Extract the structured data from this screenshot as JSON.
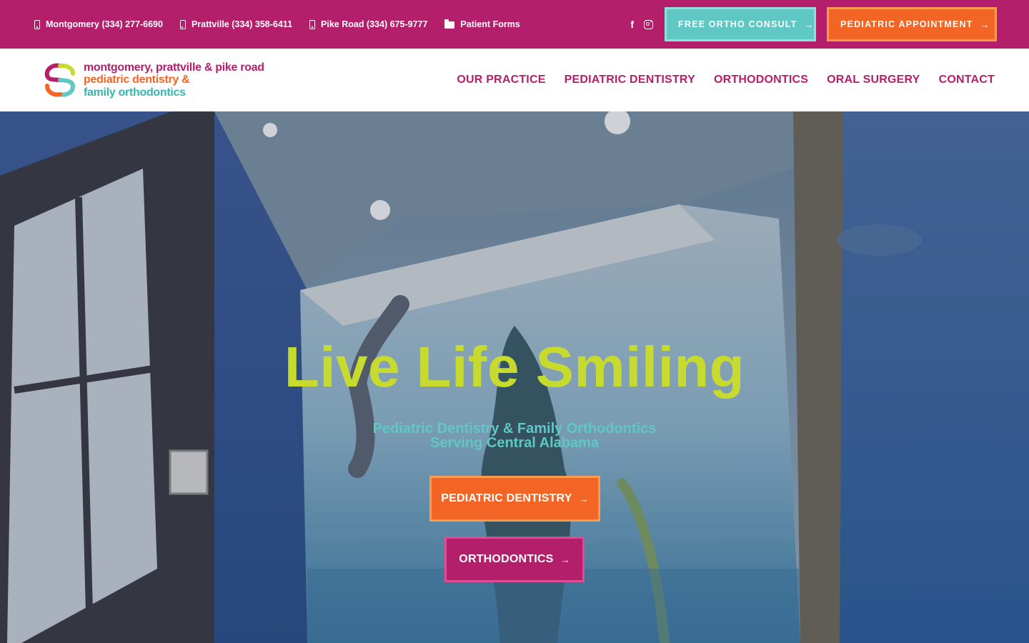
{
  "topbar": {
    "contacts": [
      {
        "label": "Montgomery (334) 277-6690",
        "icon": "phone-icon"
      },
      {
        "label": "Prattville (334) 358-6411",
        "icon": "phone-icon"
      },
      {
        "label": "Pike Road (334) 675-9777",
        "icon": "phone-icon"
      },
      {
        "label": "Patient Forms",
        "icon": "folder-icon"
      }
    ],
    "social": {
      "facebook": "f",
      "instagram": "instagram-icon"
    },
    "buttons": {
      "ortho_consult": "FREE ORTHO CONSULT",
      "pediatric_appointment": "PEDIATRIC APPOINTMENT",
      "arrow": "→"
    }
  },
  "header": {
    "logo": {
      "line1": "montgomery, prattville & pike road",
      "line2": "pediatric dentistry &",
      "line3": "family orthodontics"
    },
    "nav": [
      "OUR PRACTICE",
      "PEDIATRIC DENTISTRY",
      "ORTHODONTICS",
      "ORAL SURGERY",
      "CONTACT"
    ]
  },
  "hero": {
    "title": "Live Life Smiling",
    "subtitle_line1": "Pediatric Dentistry & Family Orthodontics",
    "subtitle_line2": "Serving Central Alabama",
    "buttons": {
      "pediatric": "PEDIATRIC DENTISTRY",
      "ortho": "ORTHODONTICS",
      "arrow": "→"
    }
  },
  "colors": {
    "magenta": "#b31f6a",
    "orange": "#f26524",
    "teal": "#5fc7c4",
    "lime": "#c7db2f"
  }
}
